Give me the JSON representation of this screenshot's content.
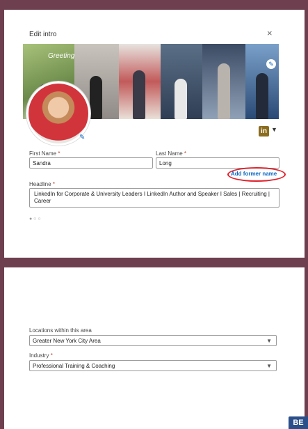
{
  "modal": {
    "title": "Edit intro",
    "close_symbol": "×"
  },
  "banner": {
    "greeting_text": "Greetings"
  },
  "form": {
    "first_name": {
      "label": "First Name",
      "required": "*",
      "value": "Sandra"
    },
    "last_name": {
      "label": "Last Name",
      "required": "*",
      "value": "Long"
    },
    "add_former_name": "Add former name",
    "headline": {
      "label": "Headline",
      "required": "*",
      "value": "LinkedIn for Corporate & University Leaders I LinkedIn Author and Speaker I Sales | Recruiting | Career"
    },
    "locations": {
      "label": "Locations within this area",
      "value": "Greater New York City Area"
    },
    "industry": {
      "label": "Industry",
      "required": "*",
      "value": "Professional Training & Coaching"
    }
  },
  "linkedin_badge": "in",
  "corner_logo": "BE",
  "colors": {
    "accent": "#0a66c2",
    "annotation": "#e0202a",
    "background": "#6e3f4e"
  }
}
